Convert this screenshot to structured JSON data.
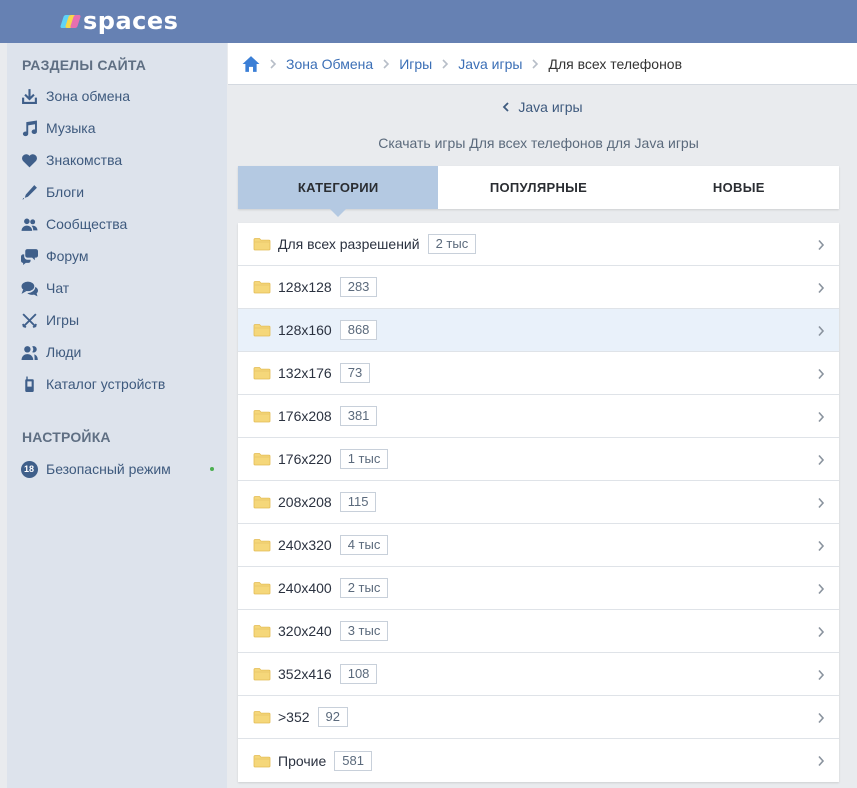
{
  "header": {
    "logo_text": "spaces"
  },
  "sidebar": {
    "section_title": "РАЗДЕЛЫ САЙТА",
    "items": [
      {
        "label": "Зона обмена",
        "icon": "download-icon"
      },
      {
        "label": "Музыка",
        "icon": "music-note-icon"
      },
      {
        "label": "Знакомства",
        "icon": "heart-icon"
      },
      {
        "label": "Блоги",
        "icon": "pen-icon"
      },
      {
        "label": "Сообщества",
        "icon": "community-icon"
      },
      {
        "label": "Форум",
        "icon": "forum-icon"
      },
      {
        "label": "Чат",
        "icon": "chat-icon"
      },
      {
        "label": "Игры",
        "icon": "crossed-swords-icon"
      },
      {
        "label": "Люди",
        "icon": "people-icon"
      },
      {
        "label": "Каталог устройств",
        "icon": "phone-icon"
      }
    ],
    "settings_title": "НАСТРОЙКА",
    "settings_items": [
      {
        "label": "Безопасный режим",
        "badge": "18",
        "status_color": "#4caf50"
      }
    ]
  },
  "breadcrumb": {
    "items": [
      "Зона Обмена",
      "Игры",
      "Java игры"
    ],
    "current": "Для всех телефонов"
  },
  "back_link": "Java игры",
  "subtitle": "Скачать игры Для всех телефонов для Java игры",
  "tabs": [
    {
      "label": "КАТЕГОРИИ",
      "active": true
    },
    {
      "label": "ПОПУЛЯРНЫЕ",
      "active": false
    },
    {
      "label": "НОВЫЕ",
      "active": false
    }
  ],
  "categories": [
    {
      "label": "Для всех разрешений",
      "count": "2 тыс"
    },
    {
      "label": "128x128",
      "count": "283"
    },
    {
      "label": "128x160",
      "count": "868"
    },
    {
      "label": "132x176",
      "count": "73"
    },
    {
      "label": "176x208",
      "count": "381"
    },
    {
      "label": "176x220",
      "count": "1 тыс"
    },
    {
      "label": "208x208",
      "count": "115"
    },
    {
      "label": "240x320",
      "count": "4 тыс"
    },
    {
      "label": "240x400",
      "count": "2 тыс"
    },
    {
      "label": "320x240",
      "count": "3 тыс"
    },
    {
      "label": "352x416",
      "count": "108"
    },
    {
      "label": ">352",
      "count": "92"
    },
    {
      "label": "Прочие",
      "count": "581"
    }
  ],
  "colors": {
    "header_bg": "#6681b3",
    "sidebar_bg": "#dde3ec",
    "active_tab": "#b4c9e2",
    "link": "#3b6fb6",
    "highlight_row": "#e9f1fa",
    "folder": "#f5d77a"
  }
}
